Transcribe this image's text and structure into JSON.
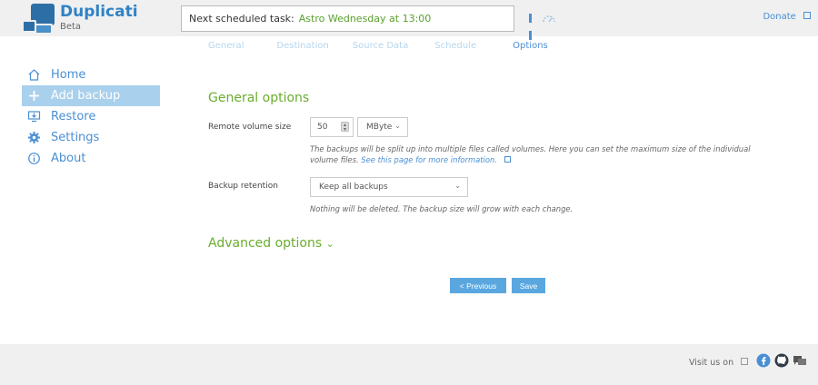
{
  "header": {
    "brand": "Duplicati",
    "brand_sub": "Beta",
    "task_label": "Next scheduled task:",
    "task_value": "Astro Wednesday at 13:00",
    "donate": "Donate"
  },
  "tabs": [
    {
      "label": "General",
      "active": false
    },
    {
      "label": "Destination",
      "active": false
    },
    {
      "label": "Source Data",
      "active": false
    },
    {
      "label": "Schedule",
      "active": false
    },
    {
      "label": "Options",
      "active": true
    }
  ],
  "sidebar": {
    "items": [
      {
        "label": "Home",
        "icon": "home-icon"
      },
      {
        "label": "Add backup",
        "icon": "plus-icon",
        "active": true
      },
      {
        "label": "Restore",
        "icon": "restore-icon"
      },
      {
        "label": "Settings",
        "icon": "gear-icon"
      },
      {
        "label": "About",
        "icon": "info-icon"
      }
    ]
  },
  "main": {
    "section_title": "General options",
    "volume_label": "Remote volume size",
    "volume_value": "50",
    "volume_unit": "MByte",
    "volume_help_1": "The backups will be split up into multiple files called volumes. Here you can set the maximum size of the individual",
    "volume_help_2": "volume files.",
    "volume_help_link": "See this page for more information.",
    "retention_label": "Backup retention",
    "retention_value": "Keep all backups",
    "retention_help": "Nothing will be deleted. The backup size will grow with each change.",
    "advanced_title": "Advanced options",
    "previous_button": "< Previous",
    "save_button": "Save"
  },
  "footer": {
    "visit": "Visit us on"
  },
  "colors": {
    "accent_blue": "#4a8fd4",
    "accent_green": "#6aad2e",
    "button_blue": "#5aa7e0"
  }
}
